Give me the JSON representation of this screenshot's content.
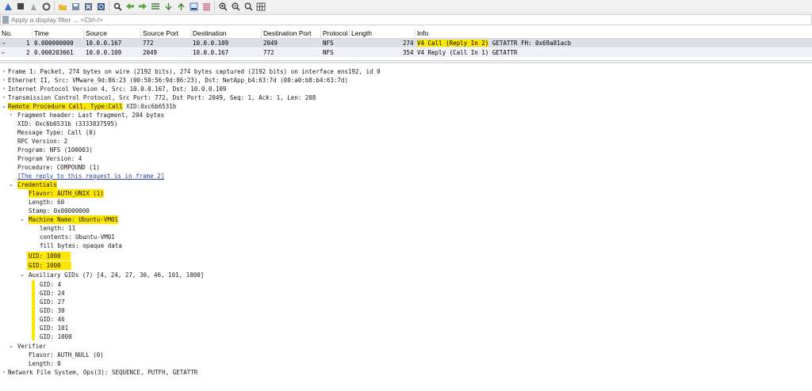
{
  "filter": {
    "placeholder": "Apply a display filter ... <Ctrl-/>"
  },
  "packet_list": {
    "columns": [
      "No.",
      "Time",
      "Source",
      "Source Port",
      "Destination",
      "Destination Port",
      "Protocol",
      "Length",
      "Info"
    ],
    "rows": [
      {
        "no": "1",
        "time": "0.000000000",
        "source": "10.0.0.167",
        "sport": "772",
        "destination": "10.0.0.109",
        "dport": "2049",
        "protocol": "NFS",
        "length": "274",
        "info_highlight": "V4 Call (Reply In 2)",
        "info_rest": " GETATTR FH: 0x69a81acb",
        "marker": "→",
        "selected": true
      },
      {
        "no": "2",
        "time": "0.000203661",
        "source": "10.0.0.109",
        "sport": "2049",
        "destination": "10.0.0.167",
        "dport": "772",
        "protocol": "NFS",
        "length": "354",
        "info_highlight": "",
        "info_rest": "V4 Reply (Call In 1) GETATTR",
        "marker": "←",
        "selected": false
      }
    ]
  },
  "tree": {
    "frame": "Frame 1: Packet, 274 bytes on wire (2192 bits), 274 bytes captured (2192 bits) on interface ens192, id 0",
    "ethernet": "Ethernet II, Src: VMware_9d:86:23 (00:50:56:9d:86:23), Dst: NetApp_b4:63:7d (00:a0:b8:b4:63:7d)",
    "ip": "Internet Protocol Version 4, Src: 10.0.0.167, Dst: 10.0.0.109",
    "tcp": "Transmission Control Protocol, Src Port: 772, Dst Port: 2049, Seq: 1, Ack: 1, Len: 208",
    "rpc_highlight": "Remote Procedure Call, Type:Call",
    "rpc_rest": " XID:0xc6b6531b",
    "fragment": "Fragment header: Last fragment, 204 bytes",
    "xid": "XID: 0xc6b6531b (3333837595)",
    "msg_type": "Message Type: Call (0)",
    "rpc_version": "RPC Version: 2",
    "program": "Program: NFS (100003)",
    "program_version": "Program Version: 4",
    "procedure": "Procedure: COMPOUND (1)",
    "reply_link": "[The reply to this request is in frame 2]",
    "credentials": "Credentials",
    "flavor": "Flavor: AUTH_UNIX (1)",
    "cred_length": "Length: 60",
    "stamp": "Stamp: 0x00000000",
    "machine_name": "Machine Name: Ubuntu-VM01",
    "mn_length": "length: 11",
    "mn_contents": "contents: Ubuntu-VM01",
    "mn_fill": "fill bytes: opaque data",
    "uid": "UID: 1000",
    "gid": "GID: 1000",
    "aux_gids": "Auxiliary GIDs (7) [4, 24, 27, 30, 46, 101, 1000]",
    "gids": [
      "GID: 4",
      "GID: 24",
      "GID: 27",
      "GID: 30",
      "GID: 46",
      "GID: 101",
      "GID: 1000"
    ],
    "verifier": "Verifier",
    "ver_flavor": "Flavor: AUTH_NULL (0)",
    "ver_length": "Length: 0",
    "nfs": "Network File System, Ops(3): SEQUENCE, PUTFH, GETATTR"
  },
  "icons": [
    "shark-fin-icon",
    "stop-icon",
    "restart-icon",
    "options-gear-icon",
    "open-folder-icon",
    "save-icon",
    "close-file-icon",
    "reload-icon",
    "find-icon",
    "back-icon",
    "forward-icon",
    "go-to-packet-icon",
    "first-packet-icon",
    "last-packet-icon",
    "autoscroll-icon",
    "colorize-icon",
    "zoom-in-icon",
    "zoom-out-icon",
    "zoom-normal-icon",
    "resize-columns-icon"
  ],
  "colors": {
    "highlight": "#ffe600",
    "selected_row": "#dadfe8",
    "link": "#2a3fa0"
  }
}
